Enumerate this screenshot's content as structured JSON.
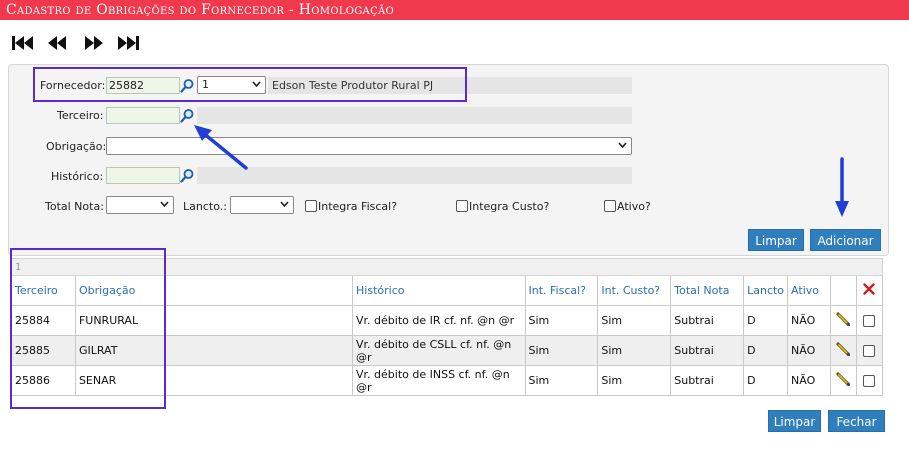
{
  "window": {
    "title": "Cadastro de Obrigações do Fornecedor   - Homologação"
  },
  "nav": {
    "first_icon": "first-icon",
    "prev_icon": "prev-icon",
    "next_icon": "next-icon",
    "last_icon": "last-icon"
  },
  "form": {
    "fornecedor_label": "Fornecedor:",
    "fornecedor_code": "25882",
    "fornecedor_option": "1",
    "fornecedor_name": "Edson Teste Produtor Rural PJ",
    "terceiro_label": "Terceiro:",
    "terceiro_code": "",
    "terceiro_name": "",
    "obrigacao_label": "Obrigação:",
    "obrigacao_value": "",
    "historico_label": "Histórico:",
    "historico_code": "",
    "historico_text": "",
    "total_nota_label": "Total Nota:",
    "total_nota_value": "",
    "lancto_label": "Lancto.:",
    "lancto_value": "",
    "integra_fiscal_label": "Integra Fiscal?",
    "integra_custo_label": "Integra Custo?",
    "ativo_label": "Ativo?",
    "limpar_label": "Limpar",
    "adicionar_label": "Adicionar"
  },
  "grid": {
    "page": "1",
    "columns": [
      "Terceiro",
      "Obrigação",
      "Histórico",
      "Int. Fiscal?",
      "Int. Custo?",
      "Total Nota",
      "Lancto",
      "Ativo"
    ],
    "rows": [
      {
        "terceiro": "25884",
        "obrigacao": "FUNRURAL",
        "historico": "Vr. débito de IR cf. nf. @n @r",
        "int_fiscal": "Sim",
        "int_custo": "Sim",
        "total_nota": "Subtrai",
        "lancto": "D",
        "ativo": "NÃO"
      },
      {
        "terceiro": "25885",
        "obrigacao": "GILRAT",
        "historico": "Vr. débito de CSLL cf. nf. @n @r",
        "int_fiscal": "Sim",
        "int_custo": "Sim",
        "total_nota": "Subtrai",
        "lancto": "D",
        "ativo": "NÃO"
      },
      {
        "terceiro": "25886",
        "obrigacao": "SENAR",
        "historico": "Vr. débito de INSS cf. nf. @n @r",
        "int_fiscal": "Sim",
        "int_custo": "Sim",
        "total_nota": "Subtrai",
        "lancto": "D",
        "ativo": "NÃO"
      }
    ]
  },
  "footer": {
    "limpar_label": "Limpar",
    "fechar_label": "Fechar"
  },
  "colors": {
    "title_bar": "#f1394e",
    "button": "#2f7fbf",
    "header_text": "#2a6fb0",
    "highlight": "#5a2bd1",
    "arrow": "#1f3fd6",
    "delete": "#cc1f1f"
  }
}
